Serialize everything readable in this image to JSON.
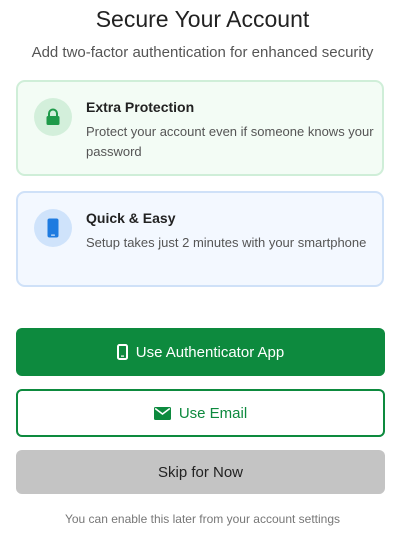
{
  "header": {
    "title": "Secure Your Account",
    "subtitle": "Add two-factor authentication for enhanced security"
  },
  "features": [
    {
      "title": "Extra Protection",
      "description": "Protect your account even if someone knows your password",
      "icon": "lock-icon",
      "accent": "#1f9a4a"
    },
    {
      "title": "Quick & Easy",
      "description": "Setup takes just 2 minutes with your smartphone",
      "icon": "smartphone-icon",
      "accent": "#1e7be0"
    }
  ],
  "actions": {
    "authenticator_label": "Use Authenticator App",
    "authenticator_icon": "smartphone-icon",
    "email_label": "Use Email",
    "email_icon": "envelope-icon",
    "skip_label": "Skip for Now"
  },
  "footnote": "You can enable this later from your account settings",
  "colors": {
    "primary": "#0d8a3e",
    "skip_bg": "#c4c4c4"
  }
}
